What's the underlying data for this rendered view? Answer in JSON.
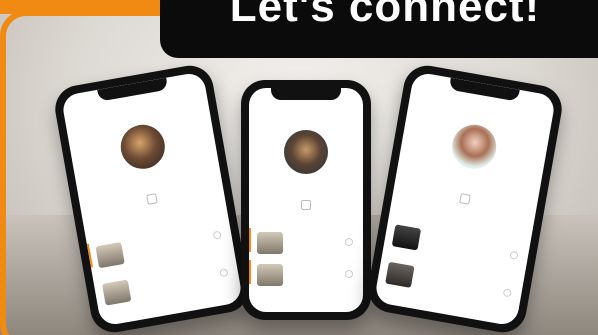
{
  "banner": {
    "text": "Let's connect!"
  },
  "phones": [
    {
      "title": "",
      "name": "",
      "items": [
        "",
        ""
      ]
    },
    {
      "title": "",
      "name": "",
      "items": [
        "",
        ""
      ]
    },
    {
      "title": "",
      "name": "",
      "items": [
        "",
        ""
      ]
    }
  ],
  "colors": {
    "accent": "#f08a12",
    "banner_bg": "#0b0b0b"
  }
}
